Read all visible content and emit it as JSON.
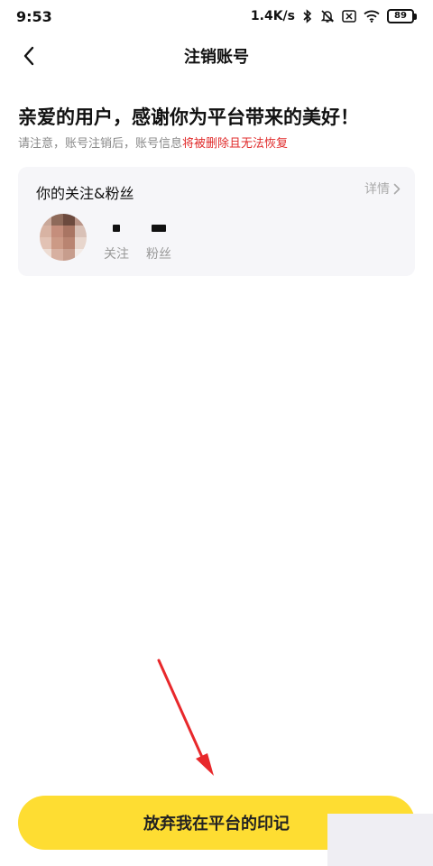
{
  "status_bar": {
    "time": "9:53",
    "network_speed": "1.4K/s",
    "battery_level": "89",
    "icons": [
      "bluetooth-icon",
      "mute-icon",
      "close-icon",
      "wifi-icon",
      "battery-icon"
    ]
  },
  "nav": {
    "title": "注销账号",
    "back_icon": "chevron-left-icon"
  },
  "intro": {
    "headline": "亲爱的用户，感谢你为平台带来的美好！",
    "notice_prefix": "请注意，账号注销后，账号信息",
    "notice_warning": "将被删除且无法恢复"
  },
  "follow_card": {
    "title": "你的关注&粉丝",
    "detail_label": "详情",
    "detail_icon": "chevron-right-icon",
    "stats": [
      {
        "label": "关注"
      },
      {
        "label": "粉丝"
      }
    ]
  },
  "primary_action": {
    "label": "放弃我在平台的印记"
  },
  "colors": {
    "accent_yellow": "#fedd32",
    "warning_red": "#e02b2b",
    "card_background": "#f6f6f9",
    "annotation_arrow": "#e8282b"
  }
}
